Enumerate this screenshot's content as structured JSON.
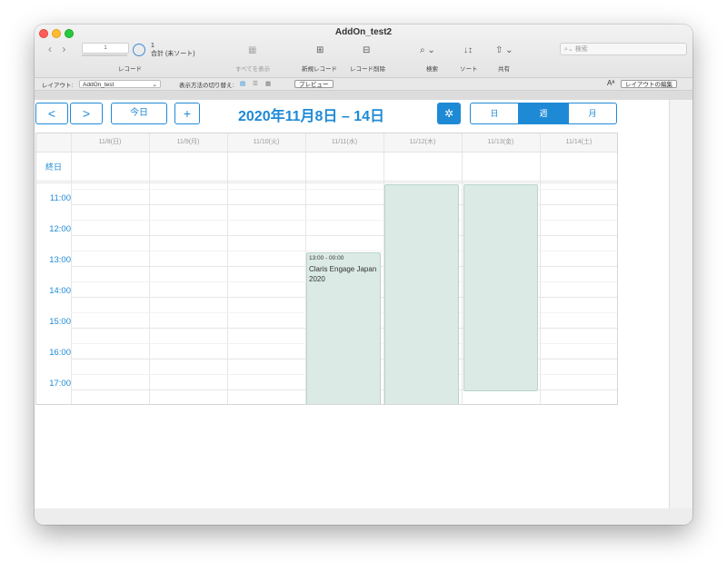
{
  "window": {
    "title": "AddOn_test2"
  },
  "toolbar": {
    "nav": "‹ ›",
    "record_slider": "1",
    "record_count": "1",
    "record_total": "合計 (未ソート)",
    "record_label": "レコード",
    "show_all": "すべてを表示",
    "new_record": "新規レコード",
    "delete_record": "レコード削除",
    "find": "検索",
    "sort": "ソート",
    "share": "共有",
    "search_placeholder": "検索"
  },
  "layoutbar": {
    "layout_label": "レイアウト:",
    "layout_value": "AddOn_test",
    "view_as_label": "表示方法の切り替え:",
    "preview": "プレビュー",
    "aa": "Aª",
    "edit_layout": "レイアウトの編集"
  },
  "calendar": {
    "prev": "<",
    "next": ">",
    "today": "今日",
    "add": "+",
    "title": "2020年11月8日 – 14日",
    "views": [
      "日",
      "週",
      "月"
    ],
    "active_view": "週",
    "days": [
      "11/8(日)",
      "11/9(月)",
      "11/10(火)",
      "11/11(水)",
      "11/12(木)",
      "11/13(金)",
      "11/14(土)"
    ],
    "allday_label": "終日",
    "hours": [
      "11:00",
      "12:00",
      "13:00",
      "14:00",
      "15:00",
      "16:00",
      "17:00"
    ],
    "events": [
      {
        "time": "13:00 - 00:00",
        "title": "Claris Engage Japan 2020"
      },
      {
        "time": "",
        "title": ""
      },
      {
        "time": "",
        "title": ""
      }
    ]
  }
}
